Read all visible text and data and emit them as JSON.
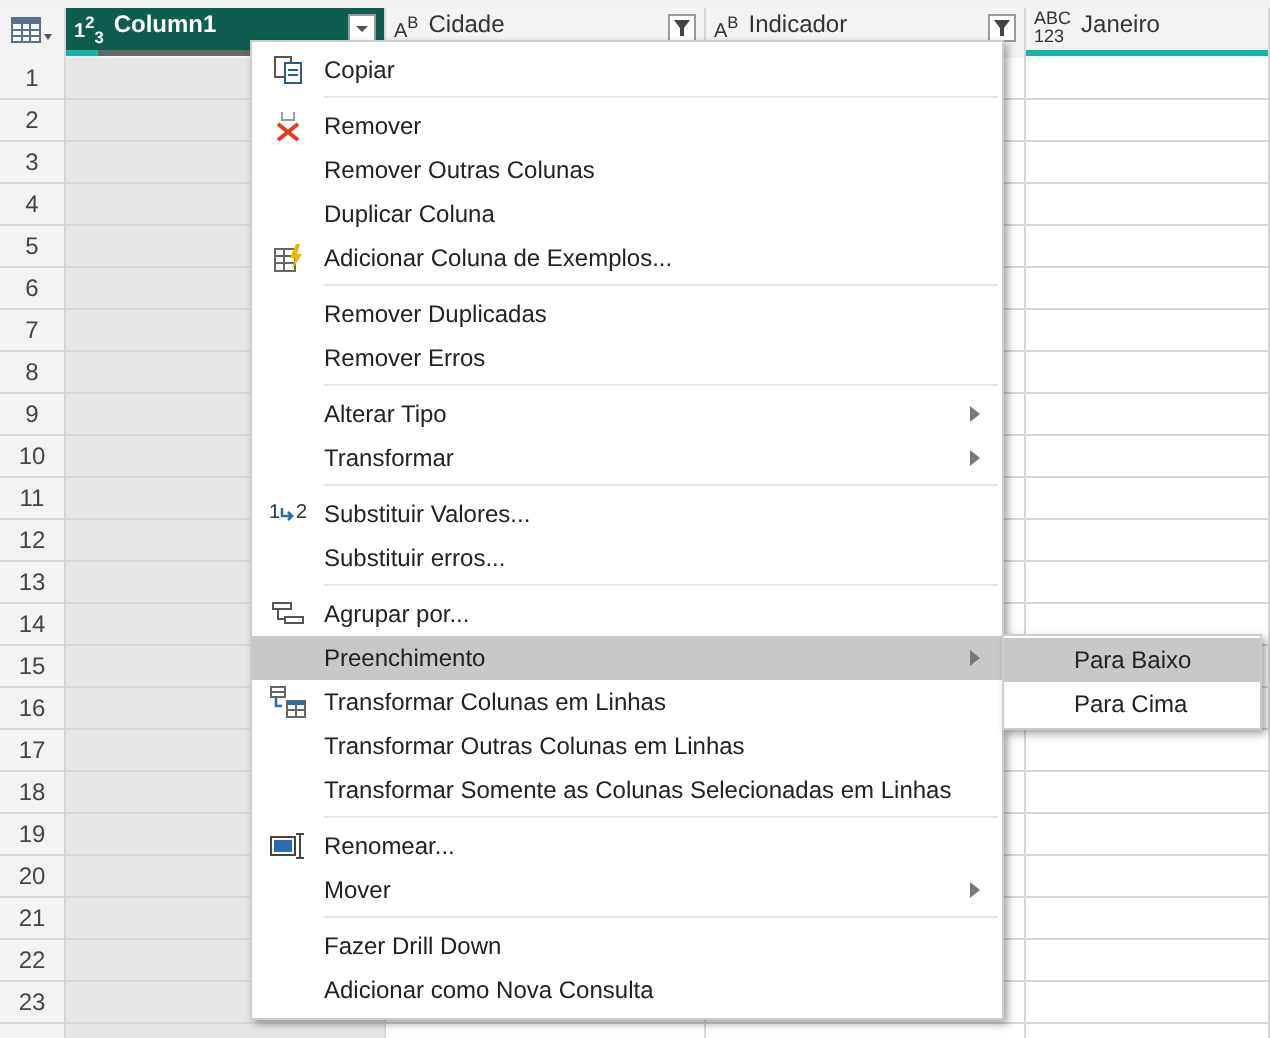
{
  "columns": [
    {
      "kind": "inline",
      "type_label": "1$^{2}$$_{3}$",
      "name": "Column1",
      "selected": true,
      "dropdown": true,
      "quality": {
        "level": 0.1
      }
    },
    {
      "kind": "inline",
      "type_label": "A$^{B}$",
      "name": "Cidade",
      "selected": false,
      "filter": true
    },
    {
      "kind": "inline",
      "type_label": "A$^{B}$",
      "name": "Indicador",
      "selected": false,
      "filter": true
    },
    {
      "kind": "stacked",
      "type_label": [
        "ABC",
        "123"
      ],
      "name": "Janeiro",
      "selected": false,
      "quality": {
        "level": 1
      }
    }
  ],
  "rows": [
    {
      "number": "1"
    },
    {
      "number": "2"
    },
    {
      "number": "3"
    },
    {
      "number": "4"
    },
    {
      "number": "5"
    },
    {
      "number": "6"
    },
    {
      "number": "7"
    },
    {
      "number": "8"
    },
    {
      "number": "9"
    },
    {
      "number": "10"
    },
    {
      "number": "11"
    },
    {
      "number": "12"
    },
    {
      "number": "13"
    },
    {
      "number": "14"
    },
    {
      "number": "15"
    },
    {
      "number": "16"
    },
    {
      "number": "17"
    },
    {
      "number": "18"
    },
    {
      "number": "19"
    },
    {
      "number": "20"
    },
    {
      "number": "21"
    },
    {
      "number": "22"
    },
    {
      "number": "23"
    }
  ],
  "context_menu": {
    "items": [
      {
        "kind": "copy",
        "label": "Copiar",
        "selected": false
      },
      {
        "kind": "separator"
      },
      {
        "kind": "remove",
        "label": "Remover",
        "selected": false
      },
      {
        "kind": "item",
        "label": "Remover Outras Colunas",
        "selected": false
      },
      {
        "kind": "item",
        "label": "Duplicar Coluna",
        "selected": false
      },
      {
        "kind": "examples",
        "label": "Adicionar Coluna de Exemplos...",
        "selected": false
      },
      {
        "kind": "separator"
      },
      {
        "kind": "item",
        "label": "Remover Duplicadas",
        "selected": false
      },
      {
        "kind": "item",
        "label": "Remover Erros",
        "selected": false
      },
      {
        "kind": "separator"
      },
      {
        "kind": "item",
        "label": "Alterar Tipo",
        "submenu": true,
        "selected": false
      },
      {
        "kind": "item",
        "label": "Transformar",
        "submenu": true,
        "selected": false
      },
      {
        "kind": "separator"
      },
      {
        "kind": "replace",
        "icon_text": [
          "1",
          "2"
        ],
        "label": "Substituir Valores...",
        "selected": false
      },
      {
        "kind": "item",
        "label": "Substituir erros...",
        "selected": false
      },
      {
        "kind": "separator"
      },
      {
        "kind": "group",
        "label": "Agrupar por...",
        "selected": false
      },
      {
        "kind": "item",
        "label": "Preenchimento",
        "submenu": true,
        "selected": true
      },
      {
        "kind": "unpivot",
        "label": "Transformar Colunas em Linhas",
        "selected": false
      },
      {
        "kind": "item",
        "label": "Transformar Outras Colunas em Linhas",
        "selected": false
      },
      {
        "kind": "item",
        "label": "Transformar Somente as Colunas Selecionadas em Linhas",
        "selected": false
      },
      {
        "kind": "separator"
      },
      {
        "kind": "rename",
        "label": "Renomear...",
        "selected": false
      },
      {
        "kind": "item",
        "label": "Mover",
        "submenu": true,
        "selected": false
      },
      {
        "kind": "separator"
      },
      {
        "kind": "item",
        "label": "Fazer Drill Down",
        "selected": false
      },
      {
        "kind": "item",
        "label": "Adicionar como Nova Consulta",
        "selected": false
      }
    ]
  },
  "submenu": {
    "items": [
      {
        "label": "Para Baixo",
        "selected": true
      },
      {
        "label": "Para Cima",
        "selected": false
      }
    ]
  }
}
